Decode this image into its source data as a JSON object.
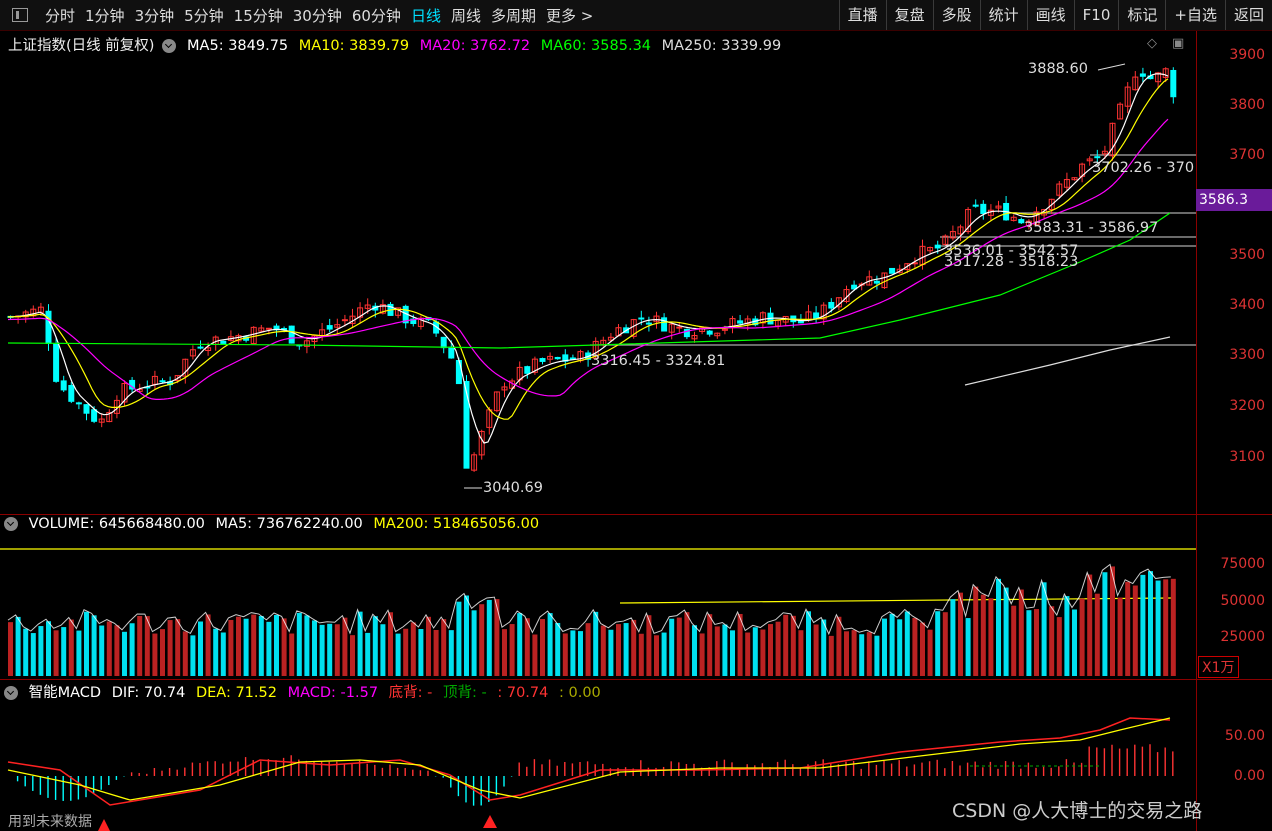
{
  "toolbar": {
    "periods": [
      "分时",
      "1分钟",
      "3分钟",
      "5分钟",
      "15分钟",
      "30分钟",
      "60分钟",
      "日线",
      "周线",
      "多周期",
      "更多 >"
    ],
    "active_period": "日线",
    "right_buttons": [
      "直播",
      "复盘",
      "多股",
      "统计",
      "画线",
      "F10",
      "标记",
      "+自选",
      "返回"
    ]
  },
  "price_pane": {
    "title": "上证指数(日线 前复权)",
    "ma": [
      {
        "label": "MA5: 3849.75",
        "color": "#ffffff"
      },
      {
        "label": "MA10: 3839.79",
        "color": "#ffff00"
      },
      {
        "label": "MA20: 3762.72",
        "color": "#ff00ff"
      },
      {
        "label": "MA60: 3585.34",
        "color": "#00ff00"
      },
      {
        "label": "MA250: 3339.99",
        "color": "#dddddd"
      }
    ],
    "y_ticks": [
      "3900",
      "3800",
      "3700",
      "3600",
      "3500",
      "3400",
      "3300",
      "3200",
      "3100"
    ],
    "current_price_tag": "3586.3",
    "annotations": {
      "high": "3888.60",
      "low": "3040.69",
      "zone1": "3702.26 - 370",
      "zone2": "3583.31 - 3586.97",
      "zone3": "3536.01 - 3542.57",
      "zone4": "3517.28 - 3518.23",
      "zone5": "3316.45 - 3324.81"
    }
  },
  "volume_pane": {
    "title": "VOLUME: 645668480.00",
    "ma5": "MA5: 736762240.00",
    "ma200": "MA200: 518465056.00",
    "y_ticks": [
      "75000",
      "50000",
      "25000"
    ],
    "unit": "X1万"
  },
  "macd_pane": {
    "title": "智能MACD",
    "dif": "DIF: 70.74",
    "dea": "DEA: 71.52",
    "macd": "MACD: -1.57",
    "bottom_div": "底背: -",
    "top_div": "顶背: -",
    "val1": ": 70.74",
    "val2": ": 0.00",
    "y_ticks": [
      "50.00",
      "0.00"
    ],
    "footer_note": "用到未来数据"
  },
  "watermark": "CSDN @人大博士的交易之路",
  "colors": {
    "up": "#ff3333",
    "down": "#00ffff",
    "grid": "#8b0000",
    "axis": "#d33333"
  }
}
